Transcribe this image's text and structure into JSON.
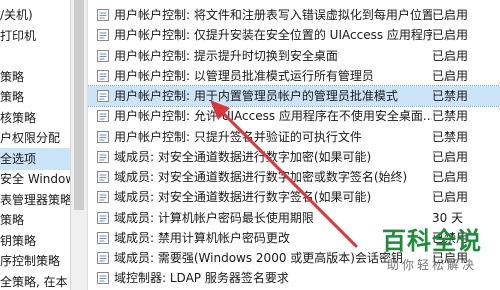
{
  "tree": {
    "items": [
      {
        "label": "/关机)"
      },
      {
        "label": "打印机"
      },
      {
        "label": ""
      },
      {
        "label": "策略"
      },
      {
        "label": "策略"
      },
      {
        "label": "核策略"
      },
      {
        "label": "户权限分配"
      },
      {
        "label": "全选项",
        "selected": true
      },
      {
        "label": "安全 Windows"
      },
      {
        "label": "表管理器策略"
      },
      {
        "label": "策略"
      },
      {
        "label": "钥策略"
      },
      {
        "label": "序控制策略"
      },
      {
        "label": "全策略, 在本"
      }
    ]
  },
  "policies": [
    {
      "name": "用户帐户控制: 将文件和注册表写入错误虚拟化到每用户位置",
      "state": "已启用"
    },
    {
      "name": "用户帐户控制: 仅提升安装在安全位置的 UIAccess 应用程序",
      "state": "已启用"
    },
    {
      "name": "用户帐户控制: 提示提升时切换到安全桌面",
      "state": "已启用"
    },
    {
      "name": "用户帐户控制: 以管理员批准模式运行所有管理员",
      "state": "已启用"
    },
    {
      "name": "用户帐户控制: 用于内置管理员帐户的管理员批准模式",
      "state": "已禁用",
      "selected": true
    },
    {
      "name": "用户帐户控制: 允许 UIAccess 应用程序在不使用安全桌面...",
      "state": "已禁用"
    },
    {
      "name": "用户帐户控制: 只提升签名并验证的可执行文件",
      "state": "已禁用"
    },
    {
      "name": "域成员: 对安全通道数据进行数字加密(如果可能)",
      "state": "已启用"
    },
    {
      "name": "域成员: 对安全通道数据进行数字加密或数字签名(始终)",
      "state": "已启用"
    },
    {
      "name": "域成员: 对安全通道数据进行数字签名(如果可能)",
      "state": "已启用"
    },
    {
      "name": "域成员: 计算机帐户密码最长使用期限",
      "state": "30 天"
    },
    {
      "name": "域成员: 禁用计算机帐户密码更改",
      "state": "已禁用"
    },
    {
      "name": "域成员: 需要强(Windows 2000 或更高版本)会话密钥",
      "state": "已启用"
    },
    {
      "name": "域控制器: LDAP 服务器签名要求",
      "state": ""
    }
  ],
  "watermark": {
    "brand": "百科全说",
    "tagline": "助你轻松解决"
  },
  "colors": {
    "selection": "#cce4f7",
    "arrow": "#d9363e",
    "brand": "#1e8c3a"
  },
  "icons": {
    "policy": "policy-setting-icon"
  }
}
